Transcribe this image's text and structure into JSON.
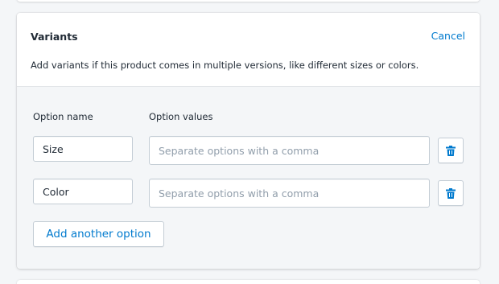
{
  "card": {
    "title": "Variants",
    "cancel_label": "Cancel",
    "description": "Add variants if this product comes in multiple versions, like different sizes or colors."
  },
  "options": {
    "name_column_label": "Option name",
    "values_column_label": "Option values",
    "rows": [
      {
        "name": "Size",
        "values": "",
        "values_placeholder": "Separate options with a comma",
        "delete_icon": "trash-icon"
      },
      {
        "name": "Color",
        "values": "",
        "values_placeholder": "Separate options with a comma",
        "delete_icon": "trash-icon"
      }
    ],
    "add_label": "Add another option"
  },
  "colors": {
    "accent": "#007ace",
    "background": "#f4f6f8",
    "border": "#c4cdd5",
    "placeholder": "#919eab"
  }
}
